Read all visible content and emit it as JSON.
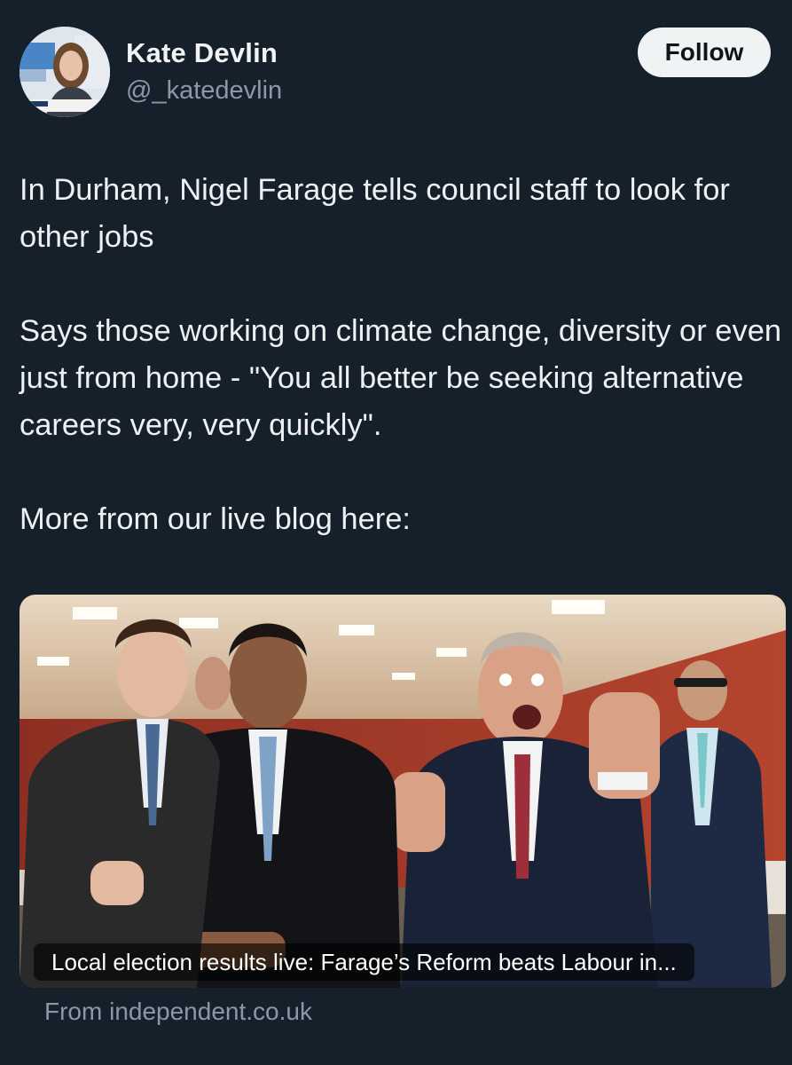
{
  "author": {
    "name": "Kate Devlin",
    "handle": "@_katedevlin",
    "follow_label": "Follow"
  },
  "tweet": {
    "paragraphs": [
      "In Durham, Nigel Farage tells council staff to look for other jobs",
      "Says those working on climate change, diversity or even just from home - \"You all better be seeking alternative careers very, very quickly\".",
      "More from our live blog here:"
    ]
  },
  "link_card": {
    "title": "Local election results live: Farage’s Reform beats Labour in...",
    "source": "From independent.co.uk"
  },
  "colors": {
    "background": "#15202b",
    "text": "#e7e9ea",
    "secondary_text": "#8b98a5",
    "follow_button_bg": "#eff3f4"
  }
}
